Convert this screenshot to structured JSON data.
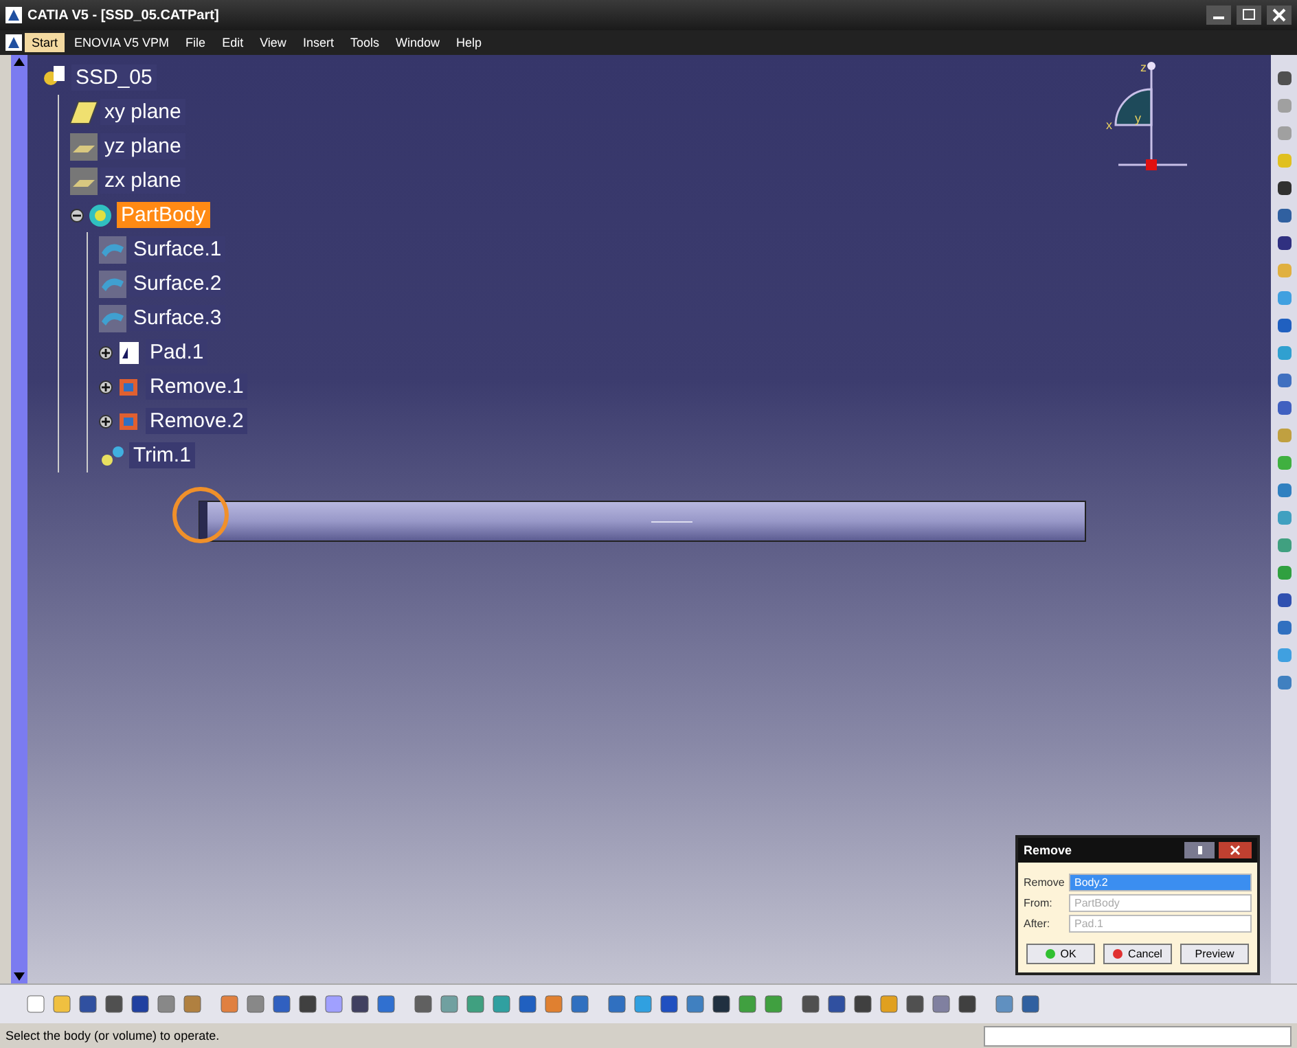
{
  "window": {
    "title": "CATIA V5 - [SSD_05.CATPart]"
  },
  "menu": [
    {
      "label": "Start",
      "selected": true
    },
    {
      "label": "ENOVIA V5 VPM",
      "selected": false
    },
    {
      "label": "File",
      "selected": false
    },
    {
      "label": "Edit",
      "selected": false
    },
    {
      "label": "View",
      "selected": false
    },
    {
      "label": "Insert",
      "selected": false
    },
    {
      "label": "Tools",
      "selected": false
    },
    {
      "label": "Window",
      "selected": false
    },
    {
      "label": "Help",
      "selected": false
    }
  ],
  "tree": {
    "label": "SSD_05",
    "kind": "part",
    "selected": false,
    "children": [
      {
        "label": "xy plane",
        "kind": "plane",
        "selected": false
      },
      {
        "label": "yz plane",
        "kind": "plane-hidden",
        "selected": false
      },
      {
        "label": "zx plane",
        "kind": "plane-hidden",
        "selected": false
      },
      {
        "label": "PartBody",
        "kind": "body",
        "selected": true,
        "expanded": true,
        "children": [
          {
            "label": "Surface.1",
            "kind": "surface",
            "selected": false
          },
          {
            "label": "Surface.2",
            "kind": "surface",
            "selected": false
          },
          {
            "label": "Surface.3",
            "kind": "surface",
            "selected": false
          },
          {
            "label": "Pad.1",
            "kind": "pad",
            "selected": false,
            "expanded": false
          },
          {
            "label": "Remove.1",
            "kind": "remove",
            "selected": false,
            "expanded": false
          },
          {
            "label": "Remove.2",
            "kind": "remove",
            "selected": false,
            "expanded": false
          },
          {
            "label": "Trim.1",
            "kind": "trim",
            "selected": false
          }
        ]
      }
    ]
  },
  "compass": {
    "labels": [
      "z",
      "x",
      "y"
    ]
  },
  "dialog": {
    "title": "Remove",
    "fields": [
      {
        "label": "Remove",
        "value": "Body.2",
        "selected": true
      },
      {
        "label": "From:",
        "value": "PartBody",
        "selected": false
      },
      {
        "label": "After:",
        "value": "Pad.1",
        "selected": false
      }
    ],
    "buttons": [
      {
        "label": "OK",
        "kind": "ok"
      },
      {
        "label": "Cancel",
        "kind": "cancel"
      },
      {
        "label": "Preview",
        "kind": "plain"
      }
    ]
  },
  "status_bar": {
    "message": "Select the body (or volume) to operate."
  }
}
